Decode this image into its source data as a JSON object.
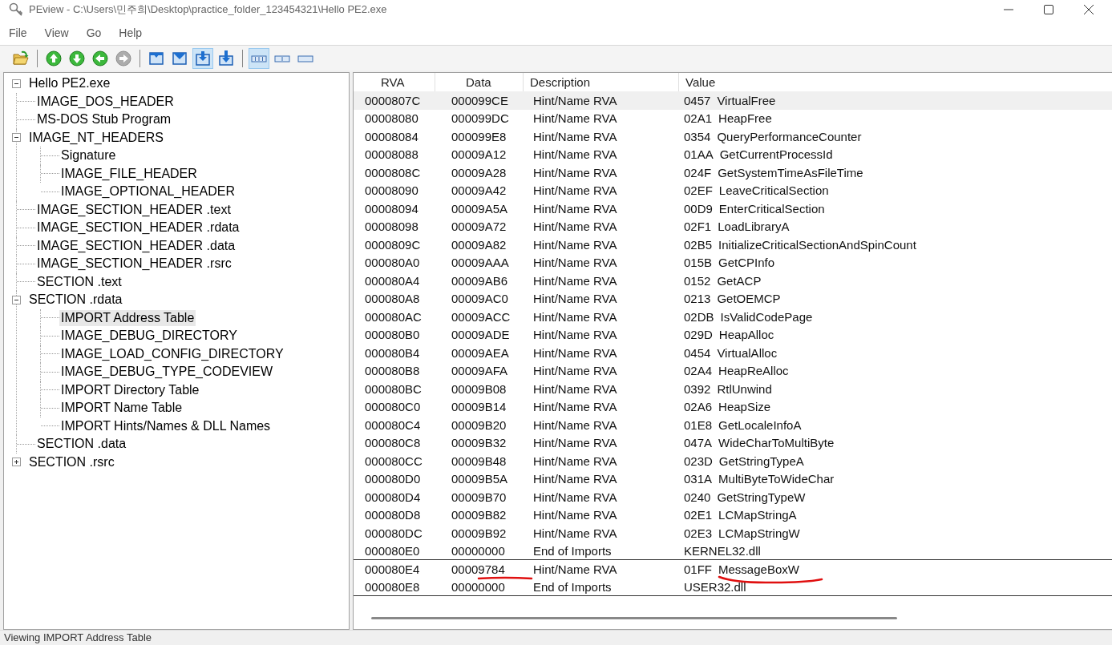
{
  "window": {
    "title": "PEview - C:\\Users\\민주희\\Desktop\\practice_folder_123454321\\Hello PE2.exe"
  },
  "menu": [
    "File",
    "View",
    "Go",
    "Help"
  ],
  "toolbar": [
    {
      "kind": "open",
      "pressed": false,
      "disabled": false
    },
    {
      "kind": "sep"
    },
    {
      "kind": "up",
      "pressed": false,
      "disabled": false
    },
    {
      "kind": "down",
      "pressed": false,
      "disabled": false
    },
    {
      "kind": "back",
      "pressed": false,
      "disabled": false
    },
    {
      "kind": "forward",
      "pressed": false,
      "disabled": true
    },
    {
      "kind": "sep"
    },
    {
      "kind": "view1",
      "pressed": false,
      "disabled": false
    },
    {
      "kind": "view2",
      "pressed": false,
      "disabled": false
    },
    {
      "kind": "view3",
      "pressed": true,
      "disabled": false
    },
    {
      "kind": "view4",
      "pressed": false,
      "disabled": false
    },
    {
      "kind": "sep"
    },
    {
      "kind": "cols4",
      "pressed": true,
      "disabled": false
    },
    {
      "kind": "cols2",
      "pressed": false,
      "disabled": false
    },
    {
      "kind": "cols1",
      "pressed": false,
      "disabled": false
    }
  ],
  "tree": [
    {
      "label": "Hello PE2.exe",
      "selected": false,
      "expanded": true,
      "children": [
        {
          "label": "IMAGE_DOS_HEADER",
          "selected": false
        },
        {
          "label": "MS-DOS Stub Program",
          "selected": false
        },
        {
          "label": "IMAGE_NT_HEADERS",
          "selected": false,
          "expanded": true,
          "children": [
            {
              "label": "Signature",
              "selected": false
            },
            {
              "label": "IMAGE_FILE_HEADER",
              "selected": false
            },
            {
              "label": "IMAGE_OPTIONAL_HEADER",
              "selected": false
            }
          ]
        },
        {
          "label": "IMAGE_SECTION_HEADER .text",
          "selected": false
        },
        {
          "label": "IMAGE_SECTION_HEADER .rdata",
          "selected": false
        },
        {
          "label": "IMAGE_SECTION_HEADER .data",
          "selected": false
        },
        {
          "label": "IMAGE_SECTION_HEADER .rsrc",
          "selected": false
        },
        {
          "label": "SECTION .text",
          "selected": false
        },
        {
          "label": "SECTION .rdata",
          "selected": false,
          "expanded": true,
          "children": [
            {
              "label": "IMPORT Address Table",
              "selected": true
            },
            {
              "label": "IMAGE_DEBUG_DIRECTORY",
              "selected": false
            },
            {
              "label": "IMAGE_LOAD_CONFIG_DIRECTORY",
              "selected": false
            },
            {
              "label": "IMAGE_DEBUG_TYPE_CODEVIEW",
              "selected": false
            },
            {
              "label": "IMPORT Directory Table",
              "selected": false
            },
            {
              "label": "IMPORT Name Table",
              "selected": false
            },
            {
              "label": "IMPORT Hints/Names & DLL Names",
              "selected": false
            }
          ]
        },
        {
          "label": "SECTION .data",
          "selected": false
        },
        {
          "label": "SECTION .rsrc",
          "selected": false,
          "expanded": false
        }
      ]
    }
  ],
  "table": {
    "columns": [
      "RVA",
      "Data",
      "Description",
      "Value"
    ],
    "rows": [
      {
        "rva": "0000807C",
        "data": "000099CE",
        "description": "Hint/Name RVA",
        "hint": "0457",
        "name": "VirtualFree",
        "selected": true,
        "separator_after": false,
        "underlined": false
      },
      {
        "rva": "00008080",
        "data": "000099DC",
        "description": "Hint/Name RVA",
        "hint": "02A1",
        "name": "HeapFree",
        "selected": false,
        "separator_after": false,
        "underlined": false
      },
      {
        "rva": "00008084",
        "data": "000099E8",
        "description": "Hint/Name RVA",
        "hint": "0354",
        "name": "QueryPerformanceCounter",
        "selected": false,
        "separator_after": false,
        "underlined": false
      },
      {
        "rva": "00008088",
        "data": "00009A12",
        "description": "Hint/Name RVA",
        "hint": "01AA",
        "name": "GetCurrentProcessId",
        "selected": false,
        "separator_after": false,
        "underlined": false
      },
      {
        "rva": "0000808C",
        "data": "00009A28",
        "description": "Hint/Name RVA",
        "hint": "024F",
        "name": "GetSystemTimeAsFileTime",
        "selected": false,
        "separator_after": false,
        "underlined": false
      },
      {
        "rva": "00008090",
        "data": "00009A42",
        "description": "Hint/Name RVA",
        "hint": "02EF",
        "name": "LeaveCriticalSection",
        "selected": false,
        "separator_after": false,
        "underlined": false
      },
      {
        "rva": "00008094",
        "data": "00009A5A",
        "description": "Hint/Name RVA",
        "hint": "00D9",
        "name": "EnterCriticalSection",
        "selected": false,
        "separator_after": false,
        "underlined": false
      },
      {
        "rva": "00008098",
        "data": "00009A72",
        "description": "Hint/Name RVA",
        "hint": "02F1",
        "name": "LoadLibraryA",
        "selected": false,
        "separator_after": false,
        "underlined": false
      },
      {
        "rva": "0000809C",
        "data": "00009A82",
        "description": "Hint/Name RVA",
        "hint": "02B5",
        "name": "InitializeCriticalSectionAndSpinCount",
        "selected": false,
        "separator_after": false,
        "underlined": false
      },
      {
        "rva": "000080A0",
        "data": "00009AAA",
        "description": "Hint/Name RVA",
        "hint": "015B",
        "name": "GetCPInfo",
        "selected": false,
        "separator_after": false,
        "underlined": false
      },
      {
        "rva": "000080A4",
        "data": "00009AB6",
        "description": "Hint/Name RVA",
        "hint": "0152",
        "name": "GetACP",
        "selected": false,
        "separator_after": false,
        "underlined": false
      },
      {
        "rva": "000080A8",
        "data": "00009AC0",
        "description": "Hint/Name RVA",
        "hint": "0213",
        "name": "GetOEMCP",
        "selected": false,
        "separator_after": false,
        "underlined": false
      },
      {
        "rva": "000080AC",
        "data": "00009ACC",
        "description": "Hint/Name RVA",
        "hint": "02DB",
        "name": "IsValidCodePage",
        "selected": false,
        "separator_after": false,
        "underlined": false
      },
      {
        "rva": "000080B0",
        "data": "00009ADE",
        "description": "Hint/Name RVA",
        "hint": "029D",
        "name": "HeapAlloc",
        "selected": false,
        "separator_after": false,
        "underlined": false
      },
      {
        "rva": "000080B4",
        "data": "00009AEA",
        "description": "Hint/Name RVA",
        "hint": "0454",
        "name": "VirtualAlloc",
        "selected": false,
        "separator_after": false,
        "underlined": false
      },
      {
        "rva": "000080B8",
        "data": "00009AFA",
        "description": "Hint/Name RVA",
        "hint": "02A4",
        "name": "HeapReAlloc",
        "selected": false,
        "separator_after": false,
        "underlined": false
      },
      {
        "rva": "000080BC",
        "data": "00009B08",
        "description": "Hint/Name RVA",
        "hint": "0392",
        "name": "RtlUnwind",
        "selected": false,
        "separator_after": false,
        "underlined": false
      },
      {
        "rva": "000080C0",
        "data": "00009B14",
        "description": "Hint/Name RVA",
        "hint": "02A6",
        "name": "HeapSize",
        "selected": false,
        "separator_after": false,
        "underlined": false
      },
      {
        "rva": "000080C4",
        "data": "00009B20",
        "description": "Hint/Name RVA",
        "hint": "01E8",
        "name": "GetLocaleInfoA",
        "selected": false,
        "separator_after": false,
        "underlined": false
      },
      {
        "rva": "000080C8",
        "data": "00009B32",
        "description": "Hint/Name RVA",
        "hint": "047A",
        "name": "WideCharToMultiByte",
        "selected": false,
        "separator_after": false,
        "underlined": false
      },
      {
        "rva": "000080CC",
        "data": "00009B48",
        "description": "Hint/Name RVA",
        "hint": "023D",
        "name": "GetStringTypeA",
        "selected": false,
        "separator_after": false,
        "underlined": false
      },
      {
        "rva": "000080D0",
        "data": "00009B5A",
        "description": "Hint/Name RVA",
        "hint": "031A",
        "name": "MultiByteToWideChar",
        "selected": false,
        "separator_after": false,
        "underlined": false
      },
      {
        "rva": "000080D4",
        "data": "00009B70",
        "description": "Hint/Name RVA",
        "hint": "0240",
        "name": "GetStringTypeW",
        "selected": false,
        "separator_after": false,
        "underlined": false
      },
      {
        "rva": "000080D8",
        "data": "00009B82",
        "description": "Hint/Name RVA",
        "hint": "02E1",
        "name": "LCMapStringA",
        "selected": false,
        "separator_after": false,
        "underlined": false
      },
      {
        "rva": "000080DC",
        "data": "00009B92",
        "description": "Hint/Name RVA",
        "hint": "02E3",
        "name": "LCMapStringW",
        "selected": false,
        "separator_after": false,
        "underlined": false
      },
      {
        "rva": "000080E0",
        "data": "00000000",
        "description": "End of Imports",
        "name": "KERNEL32.dll",
        "selected": false,
        "separator_after": true,
        "underlined": false
      },
      {
        "rva": "000080E4",
        "data": "00009784",
        "description": "Hint/Name RVA",
        "hint": "01FF",
        "name": "MessageBoxW",
        "selected": false,
        "separator_after": false,
        "underlined": true
      },
      {
        "rva": "000080E8",
        "data": "00000000",
        "description": "End of Imports",
        "name": "USER32.dll",
        "selected": false,
        "separator_after": true,
        "underlined": false
      }
    ]
  },
  "status_bar": "Viewing IMPORT Address Table"
}
